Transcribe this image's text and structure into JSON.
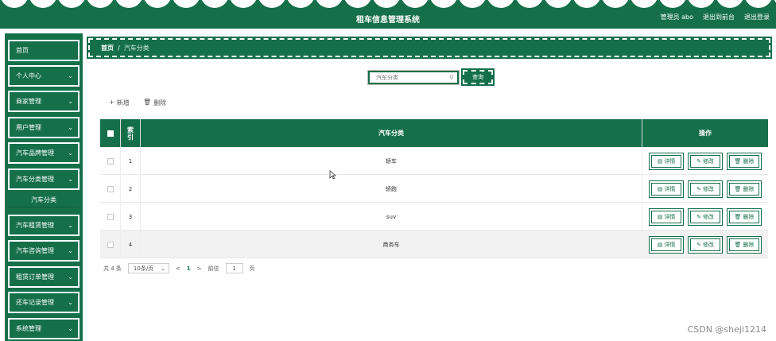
{
  "header": {
    "title": "租车信息管理系统",
    "user_label": "管理员 abo",
    "back_link": "退出到前台",
    "logout_link": "退出登录"
  },
  "sidebar": {
    "items": [
      {
        "label": "首页",
        "has_chevron": false
      },
      {
        "label": "个人中心",
        "has_chevron": true
      },
      {
        "label": "商家管理",
        "has_chevron": true
      },
      {
        "label": "用户管理",
        "has_chevron": true
      },
      {
        "label": "汽车品牌管理",
        "has_chevron": true
      },
      {
        "label": "汽车分类管理",
        "has_chevron": true
      },
      {
        "label": "汽车租赁管理",
        "has_chevron": true
      },
      {
        "label": "汽车咨询管理",
        "has_chevron": true
      },
      {
        "label": "租赁订单管理",
        "has_chevron": true
      },
      {
        "label": "还车记录管理",
        "has_chevron": true
      },
      {
        "label": "系统管理",
        "has_chevron": true
      }
    ],
    "sub_item": "汽车分类",
    "chevron": "⌄"
  },
  "breadcrumb": {
    "home": "首页",
    "separator": "/",
    "current": "汽车分类"
  },
  "search": {
    "placeholder": "汽车分类",
    "button_label": "查询",
    "icon": "search-icon"
  },
  "actions": {
    "add_label": "新增",
    "add_icon": "+",
    "delete_label": "删除",
    "delete_icon": "🗑"
  },
  "table": {
    "headers": {
      "index": "索引",
      "name": "汽车分类",
      "ops": "操作"
    },
    "rows": [
      {
        "index": "1",
        "name": "轿车"
      },
      {
        "index": "2",
        "name": "轿跑"
      },
      {
        "index": "3",
        "name": "suv"
      },
      {
        "index": "4",
        "name": "商务车"
      }
    ],
    "row_buttons": {
      "detail": "详情",
      "edit": "修改",
      "delete": "删除"
    }
  },
  "pagination": {
    "total": "共 4 条",
    "page_size": "10条/页",
    "prev": "<",
    "current_page": "1",
    "next": ">",
    "goto_label": "前往",
    "goto_value": "1",
    "page_suffix": "页"
  },
  "watermark": "CSDN @sheji1214",
  "colors": {
    "primary": "#15704a",
    "background": "#ffffff"
  }
}
